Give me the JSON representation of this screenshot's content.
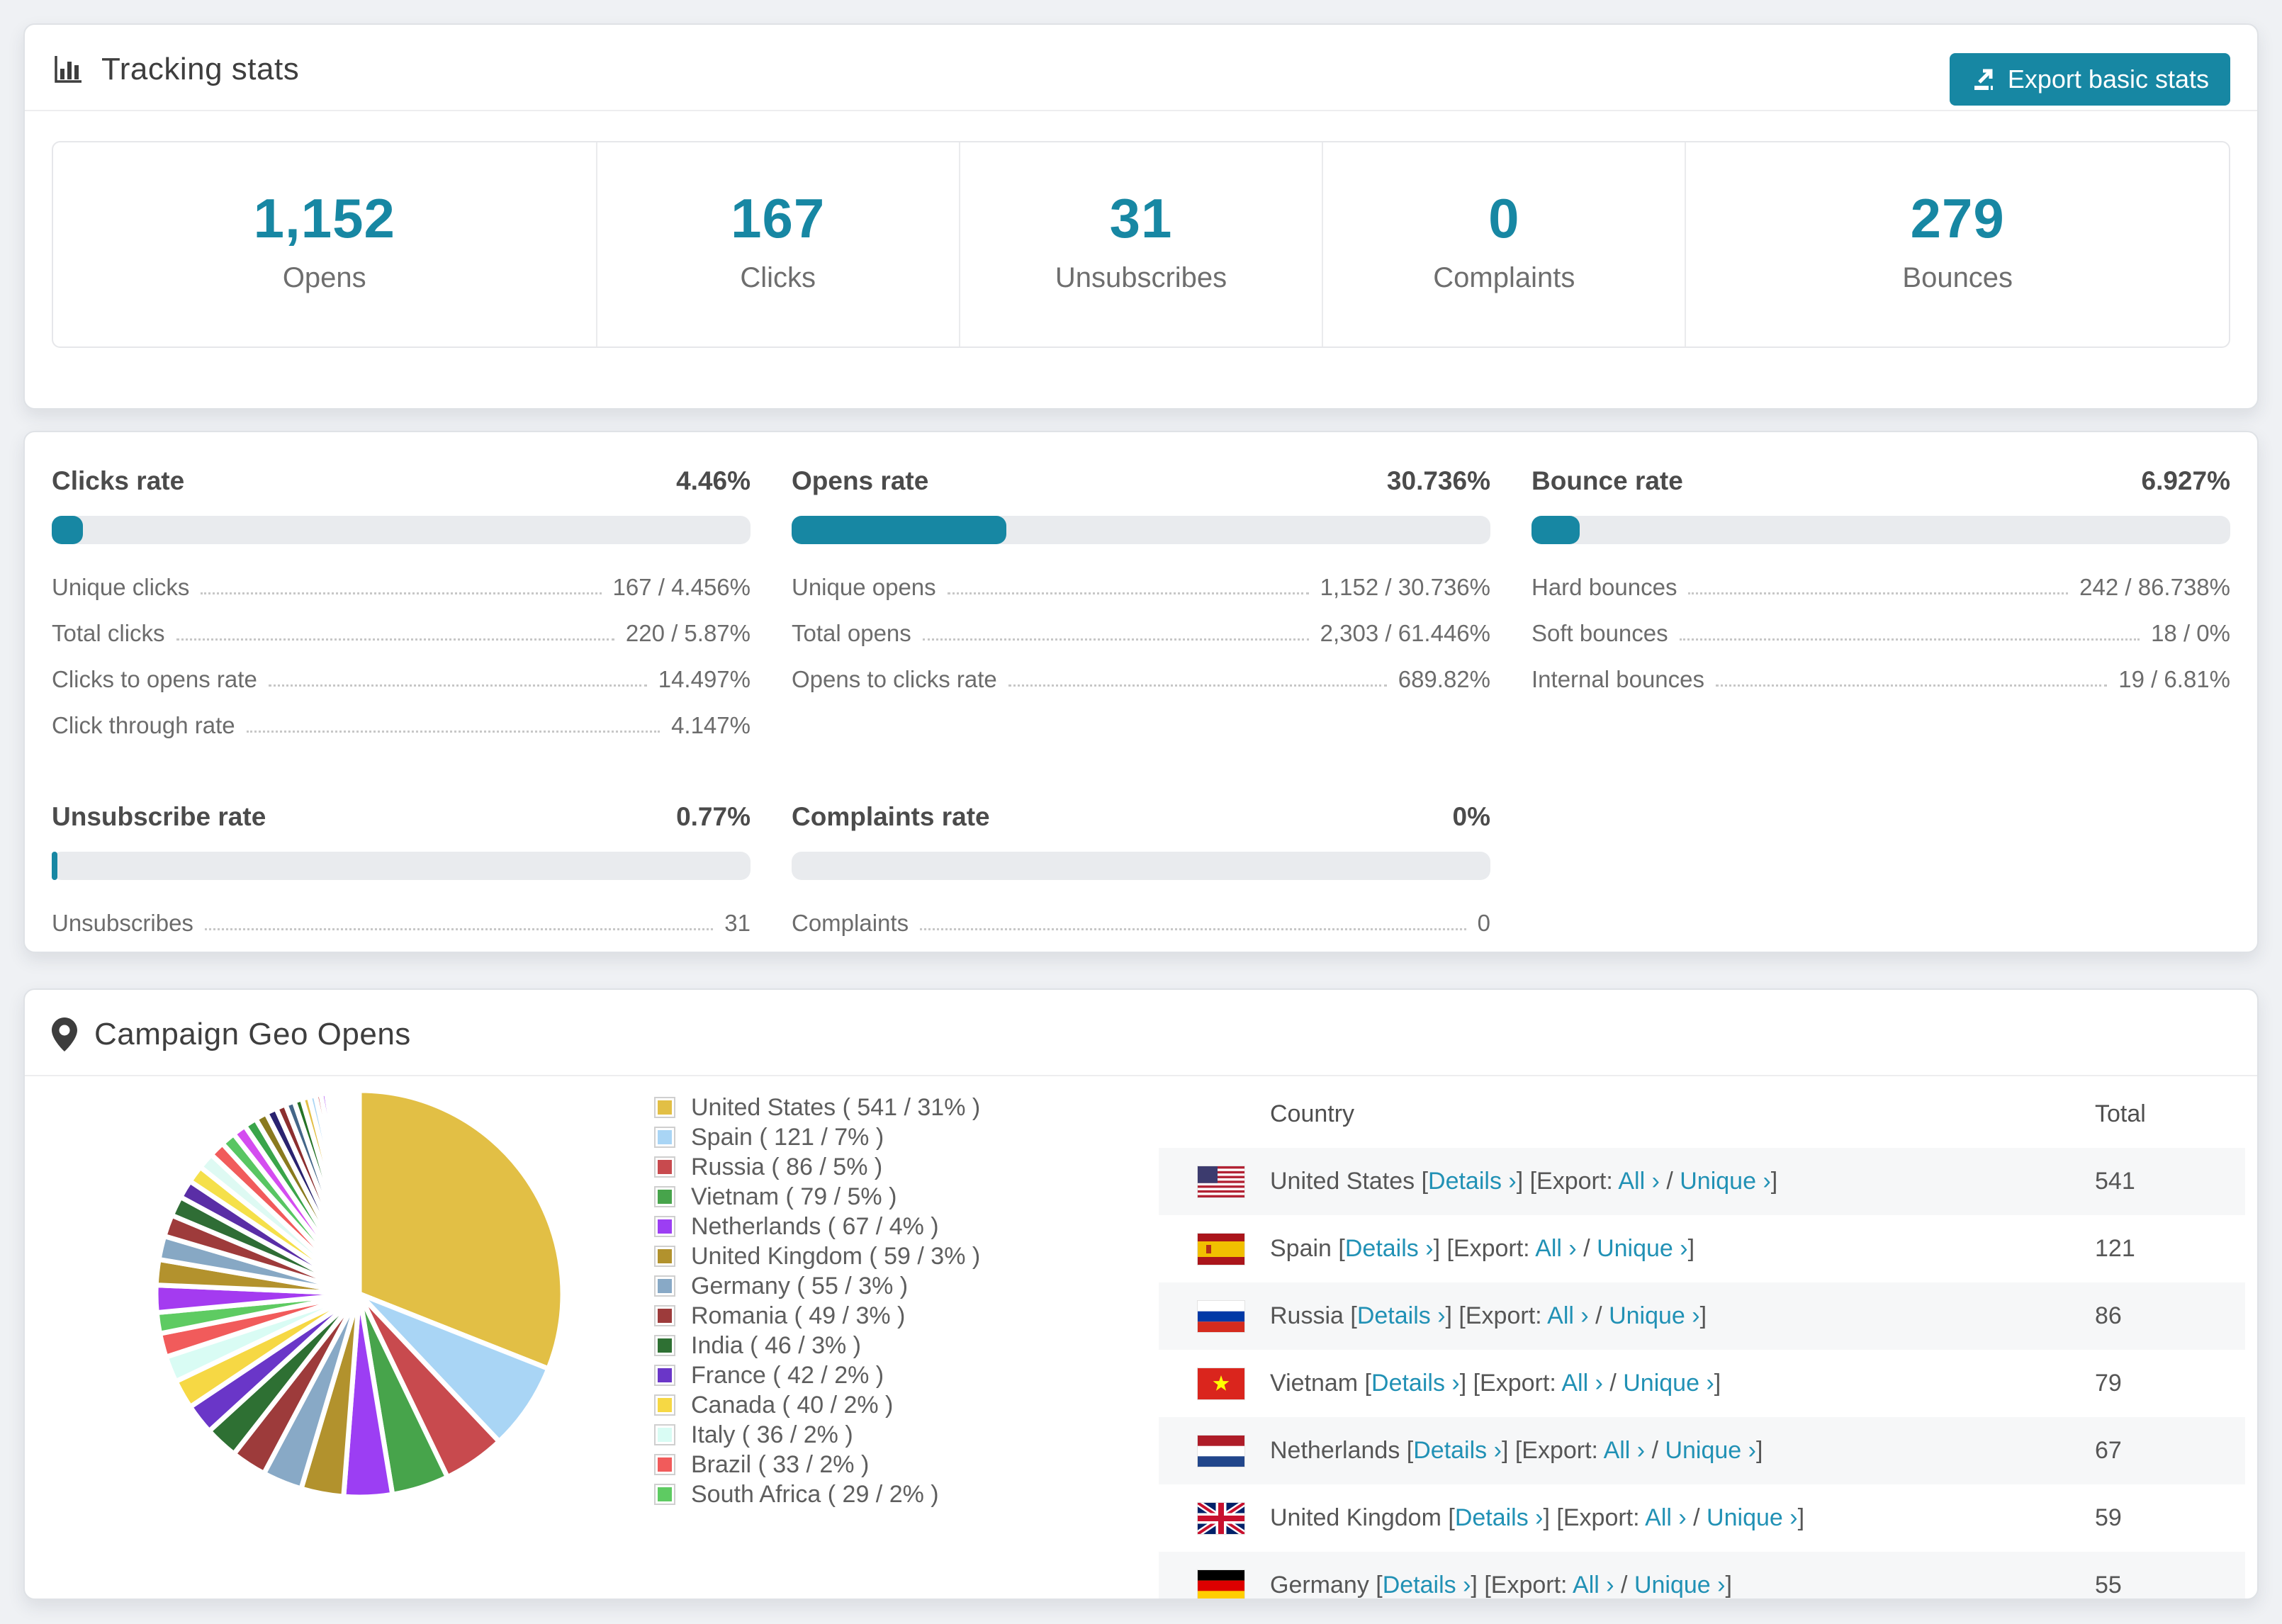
{
  "accent": "#1787a3",
  "link_color": "#2191b5",
  "tracking": {
    "title": "Tracking stats",
    "export_label": "Export basic stats",
    "stats": [
      {
        "value": "1,152",
        "label": "Opens"
      },
      {
        "value": "167",
        "label": "Clicks"
      },
      {
        "value": "31",
        "label": "Unsubscribes"
      },
      {
        "value": "0",
        "label": "Complaints"
      },
      {
        "value": "279",
        "label": "Bounces"
      }
    ]
  },
  "rates": {
    "panels": [
      {
        "title": "Clicks rate",
        "value": "4.46%",
        "percent": 4.46,
        "rows": [
          [
            "Unique clicks",
            "167 / 4.456%"
          ],
          [
            "Total clicks",
            "220 / 5.87%"
          ],
          [
            "Clicks to opens rate",
            "14.497%"
          ],
          [
            "Click through rate",
            "4.147%"
          ]
        ]
      },
      {
        "title": "Opens rate",
        "value": "30.736%",
        "percent": 30.736,
        "rows": [
          [
            "Unique opens",
            "1,152 / 30.736%"
          ],
          [
            "Total opens",
            "2,303 / 61.446%"
          ],
          [
            "Opens to clicks rate",
            "689.82%"
          ]
        ]
      },
      {
        "title": "Bounce rate",
        "value": "6.927%",
        "percent": 6.927,
        "rows": [
          [
            "Hard bounces",
            "242 / 86.738%"
          ],
          [
            "Soft bounces",
            "18 / 0%"
          ],
          [
            "Internal bounces",
            "19 / 6.81%"
          ]
        ]
      },
      {
        "title": "Unsubscribe rate",
        "value": "0.77%",
        "percent": 0.77,
        "rows": [
          [
            "Unsubscribes",
            "31"
          ]
        ]
      },
      {
        "title": "Complaints rate",
        "value": "0%",
        "percent": 0,
        "rows": [
          [
            "Complaints",
            "0"
          ]
        ]
      }
    ]
  },
  "geo": {
    "title": "Campaign Geo Opens",
    "chart_data": {
      "type": "pie",
      "title": "Campaign Geo Opens",
      "legend_position": "right",
      "categories": [
        "United States",
        "Spain",
        "Russia",
        "Vietnam",
        "Netherlands",
        "United Kingdom",
        "Germany",
        "Romania",
        "India",
        "France",
        "Canada",
        "Italy",
        "Brazil",
        "South Africa"
      ],
      "values": [
        541,
        121,
        86,
        79,
        67,
        59,
        55,
        49,
        46,
        42,
        40,
        36,
        33,
        29
      ],
      "percents": [
        31,
        7,
        5,
        5,
        4,
        3,
        3,
        3,
        3,
        2,
        2,
        2,
        2,
        2
      ],
      "colors": [
        "#e2bf45",
        "#a9d5f5",
        "#c84a4e",
        "#47a44b",
        "#9c3ef3",
        "#b2922d",
        "#88a9c6",
        "#9d3b3b",
        "#2e7033",
        "#6a36c8",
        "#f6d844",
        "#d9fcf4",
        "#f15b5b",
        "#5ecb62"
      ],
      "estimated_total": 1745,
      "others_estimated_weights": [
        30,
        28,
        26,
        24,
        22,
        20,
        19,
        18,
        17,
        16,
        15,
        14,
        13,
        12,
        11,
        10,
        9,
        8,
        7,
        6,
        6,
        5,
        5,
        4,
        4,
        3,
        3,
        3,
        2,
        2,
        2,
        1,
        1,
        1
      ],
      "others_palette": [
        "#a43bf0",
        "#b3922d",
        "#87a8c4",
        "#9e3b3b",
        "#2f6d35",
        "#5a2ea6",
        "#f5e04a",
        "#defaf3",
        "#f15b5b",
        "#58c662",
        "#d44df0",
        "#3aa54a",
        "#8a7a1e",
        "#2a2370",
        "#8c2f2f",
        "#446688",
        "#267326",
        "#e2bf45",
        "#a9d5f5",
        "#c84a4e"
      ]
    },
    "legend_format": {
      "open": "( ",
      "sep": " / ",
      "close": "% )"
    },
    "table": {
      "headers": [
        "Country",
        "Total"
      ],
      "details_label": "Details ›",
      "export_prefix": "[Export:",
      "all_label": "All ›",
      "unique_label": "Unique ›",
      "rows": [
        {
          "country": "United States",
          "flag": "us",
          "total": "541"
        },
        {
          "country": "Spain",
          "flag": "es",
          "total": "121"
        },
        {
          "country": "Russia",
          "flag": "ru",
          "total": "86"
        },
        {
          "country": "Vietnam",
          "flag": "vn",
          "total": "79"
        },
        {
          "country": "Netherlands",
          "flag": "nl",
          "total": "67"
        },
        {
          "country": "United Kingdom",
          "flag": "gb",
          "total": "59"
        },
        {
          "country": "Germany",
          "flag": "de",
          "total": "55"
        }
      ]
    }
  }
}
